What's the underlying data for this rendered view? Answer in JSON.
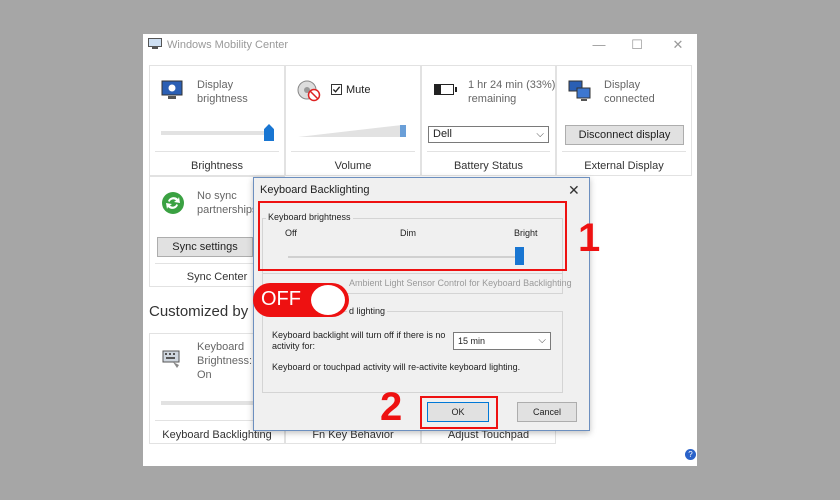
{
  "window": {
    "title": "Windows Mobility Center",
    "caption_buttons": {
      "minimize": "—",
      "maximize": "☐",
      "close": "✕"
    }
  },
  "tiles": {
    "brightness": {
      "text_line1": "Display",
      "text_line2": "brightness",
      "label": "Brightness",
      "slider_level": 1.0
    },
    "volume": {
      "mute_label": "Mute",
      "mute_checked": true,
      "label": "Volume"
    },
    "battery": {
      "text_line1": "1 hr 24 min (33%)",
      "text_line2": "remaining",
      "plan_value": "Dell",
      "label": "Battery Status",
      "level_percent": 33
    },
    "display": {
      "text_line1": "Display",
      "text_line2": "connected",
      "button": "Disconnect display",
      "label": "External Display"
    },
    "sync": {
      "text_line1": "No sync",
      "text_line2": "partnerships",
      "button": "Sync settings",
      "label": "Sync Center"
    },
    "keyboard": {
      "text_line1": "Keyboard",
      "text_line2": "Brightness:",
      "text_line3": "On",
      "label": "Keyboard Backlighting"
    },
    "fn_key": {
      "label": "Fn Key Behavior"
    },
    "touchpad": {
      "label": "Adjust Touchpad"
    }
  },
  "customized_heading": "Customized by",
  "dialog": {
    "title": "Keyboard Backlighting",
    "brightness_group": "Keyboard brightness",
    "scale": {
      "off": "Off",
      "dim": "Dim",
      "bright": "Bright"
    },
    "slider_level": 1.0,
    "ambient_checkbox": "Ambient Light Sensor Control for Keyboard Backlighting",
    "lighting_group": "d lighting",
    "timeout_label_line1": "Keyboard backlight will turn off if there is no",
    "timeout_label_line2": "activity for:",
    "timeout_value": "15 min",
    "reactivate_note": "Keyboard or touchpad activity will re-activite keyboard lighting.",
    "ok": "OK",
    "cancel": "Cancel"
  },
  "annotations": {
    "step1": "1",
    "step2": "2",
    "toggle": "OFF"
  },
  "help_icon": "?",
  "colors": {
    "annotation_red": "#ee1111",
    "slider_thumb": "#1976d2",
    "background": "#a6a6a6"
  }
}
